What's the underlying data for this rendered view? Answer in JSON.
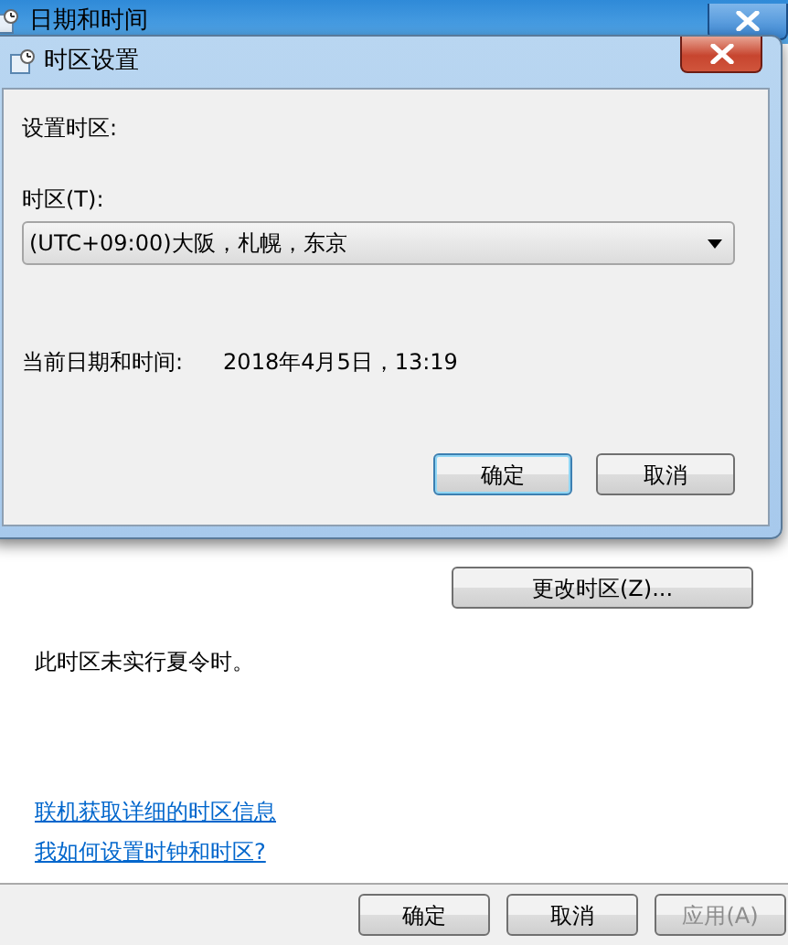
{
  "window": {
    "title": "日期和时间"
  },
  "dialog": {
    "title": "时区设置",
    "heading": "设置时区:",
    "timezone_label": "时区(T):",
    "timezone_value": "(UTC+09:00)大阪，札幌，东京",
    "current_label": "当前日期和时间:",
    "current_value": "2018年4月5日，13:19",
    "buttons": [
      {
        "label": "确定",
        "default": true
      },
      {
        "label": "取消",
        "default": false
      }
    ]
  },
  "change_button": "更改时区(Z)...",
  "dst_note": "此时区未实行夏令时。",
  "links": [
    "联机获取详细的时区信息",
    "我如何设置时钟和时区?"
  ],
  "buttons": [
    {
      "label": "确定",
      "disabled": false
    },
    {
      "label": "取消",
      "disabled": false
    },
    {
      "label": "应用(A)",
      "disabled": true
    }
  ]
}
